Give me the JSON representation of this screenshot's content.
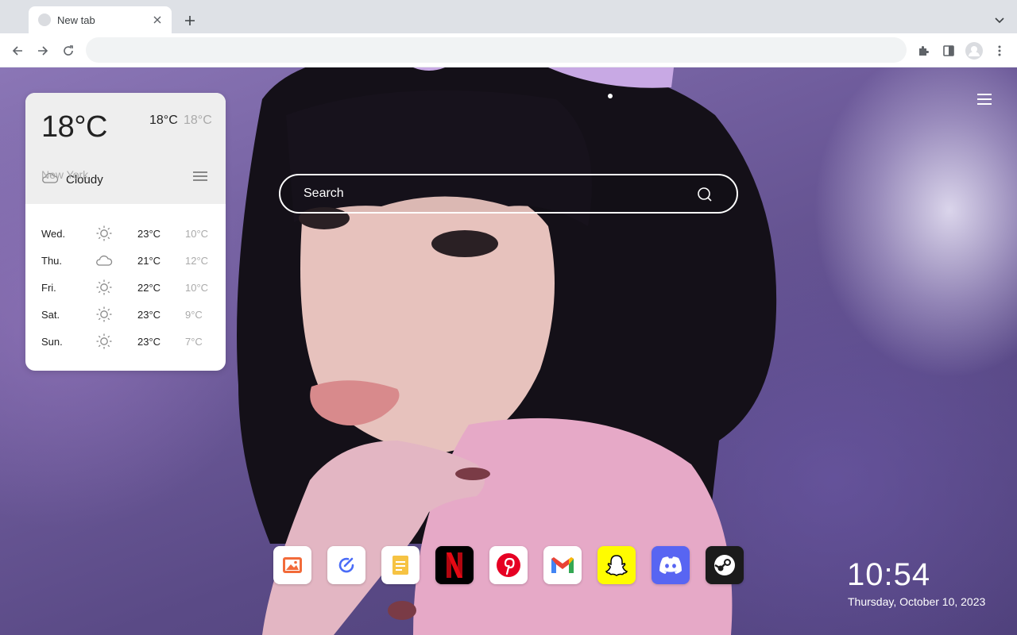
{
  "browser": {
    "tab_title": "New tab",
    "address_value": "",
    "icons": [
      "favicon",
      "close-icon",
      "plus-icon",
      "chevron-down-icon",
      "back-icon",
      "forward-icon",
      "reload-icon",
      "extensions-icon",
      "side-panel-icon",
      "profile-icon",
      "kebab-menu-icon"
    ]
  },
  "weather": {
    "current_temp": "18°C",
    "high": "18°C",
    "low": "18°C",
    "condition": "Cloudy",
    "condition_icon": "cloud-icon",
    "city": "New York",
    "forecast": [
      {
        "day": "Wed.",
        "icon": "sun-icon",
        "high": "23°C",
        "low": "10°C"
      },
      {
        "day": "Thu.",
        "icon": "cloud-icon",
        "high": "21°C",
        "low": "12°C"
      },
      {
        "day": "Fri.",
        "icon": "sun-icon",
        "high": "22°C",
        "low": "10°C"
      },
      {
        "day": "Sat.",
        "icon": "sun-icon",
        "high": "23°C",
        "low": "9°C"
      },
      {
        "day": "Sun.",
        "icon": "sun-icon",
        "high": "23°C",
        "low": "7°C"
      }
    ]
  },
  "search": {
    "placeholder": "Search"
  },
  "dock": {
    "apps": [
      "photos",
      "tasks",
      "notes",
      "netflix",
      "pinterest",
      "gmail",
      "snapchat",
      "discord",
      "steam"
    ]
  },
  "clock": {
    "time": "10:54",
    "date": "Thursday, October 10, 2023"
  },
  "colors": {
    "netflix": "#e50914",
    "pinterest": "#e60023",
    "snapchat": "#fffc00",
    "discord": "#5865f2",
    "steam": "#1b1b1b"
  }
}
